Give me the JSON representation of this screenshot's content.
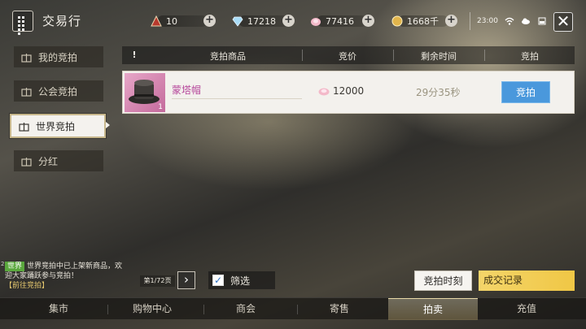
{
  "header": {
    "title": "交易行",
    "resources": [
      {
        "icon": "level-triangle-icon",
        "value": "10",
        "color": "#c0392b"
      },
      {
        "icon": "diamond-icon",
        "value": "17218",
        "color": "#9fd3f5"
      },
      {
        "icon": "pink-shell-icon",
        "value": "77416",
        "color": "#f2b8c6"
      },
      {
        "icon": "gold-coin-icon",
        "value": "1668千",
        "color": "#e0b64a"
      }
    ],
    "time": "23:00"
  },
  "nav": {
    "items": [
      {
        "label": "我的竞拍"
      },
      {
        "label": "公会竞拍"
      },
      {
        "label": "世界竞拍"
      },
      {
        "label": "分红"
      }
    ]
  },
  "table": {
    "headers": [
      "竞拍商品",
      "竞价",
      "剩余时间",
      "竞拍"
    ],
    "rows": [
      {
        "name": "蒙塔帽",
        "qty": "1",
        "price": "12000",
        "time_left": "29分35秒",
        "action": "竞拍"
      }
    ]
  },
  "chat": {
    "tag": "世界",
    "message": "世界竞拍中已上架新商品，欢迎大家踊跃参与竞拍！",
    "link": "【前往竞拍】",
    "index": "2"
  },
  "pager": {
    "label": "第1/72页",
    "next": "›"
  },
  "filter": {
    "label": "筛选",
    "checked": true
  },
  "actions": {
    "time_button": "竞拍时刻",
    "record_button": "成交记录"
  },
  "tabs": [
    "集市",
    "购物中心",
    "商会",
    "寄售",
    "拍卖",
    "充值"
  ],
  "colors": {
    "accent_blue": "#4a98dc",
    "accent_gold": "#f0c745",
    "item_purple": "#b6479b"
  }
}
